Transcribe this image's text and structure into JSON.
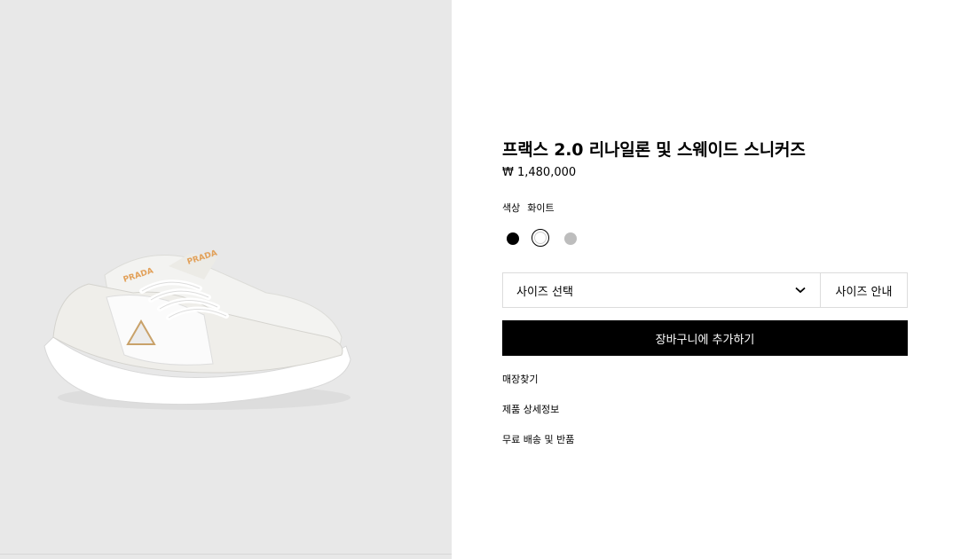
{
  "product": {
    "title": "프랙스 2.0 리나일론 및 스웨이드 스니커즈",
    "price": "₩ 1,480,000",
    "color_label": "색상",
    "color_value": "화이트",
    "swatches": [
      {
        "name": "black",
        "color": "#000000"
      },
      {
        "name": "white",
        "color": "#ffffff",
        "selected": true
      },
      {
        "name": "grey",
        "color": "#bdbdbd"
      }
    ]
  },
  "size": {
    "select_label": "사이즈 선택",
    "guide_label": "사이즈 안내"
  },
  "cart": {
    "button_label": "장바구니에 추가하기"
  },
  "links": {
    "store_finder": "매장찾기",
    "product_details": "제품 상세정보",
    "shipping_returns": "무료 배송 및 반품"
  },
  "image": {
    "background": "#e8e8e8",
    "logo_text": "PRADA"
  }
}
